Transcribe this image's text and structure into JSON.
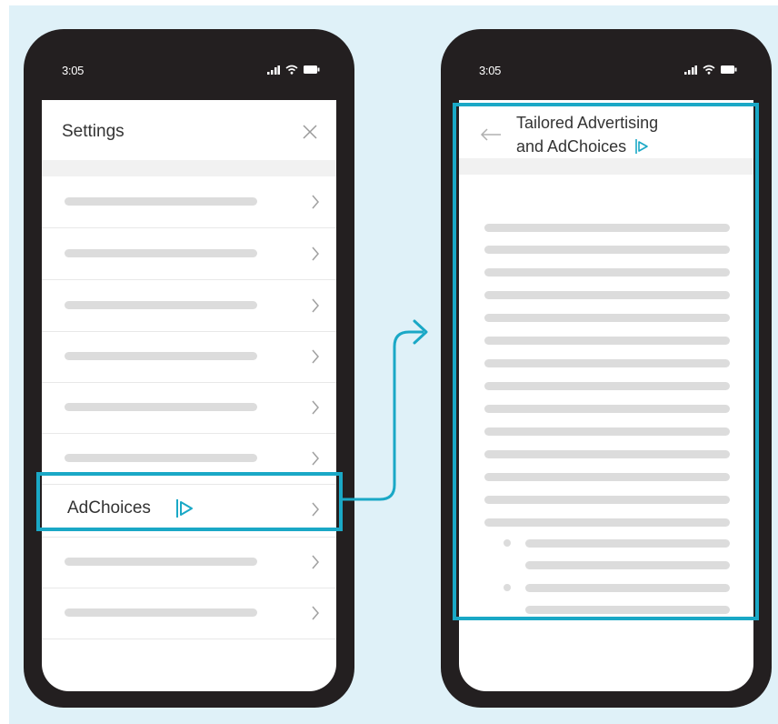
{
  "status_bar": {
    "time_left": "3:05",
    "time_right": "3:05"
  },
  "settings": {
    "title": "Settings",
    "adchoices_label": "AdChoices"
  },
  "detail": {
    "title_line1": "Tailored Advertising",
    "title_line2": "and AdChoices"
  },
  "colors": {
    "accent": "#1aa8c6",
    "phone_frame": "#231f20",
    "backdrop": "#dff1f8",
    "placeholder": "#dcdcdc"
  },
  "icons": [
    "signal-icon",
    "wifi-icon",
    "battery-icon",
    "close-icon",
    "chevron-right-icon",
    "adchoices-icon",
    "back-arrow-icon",
    "flow-arrow"
  ]
}
